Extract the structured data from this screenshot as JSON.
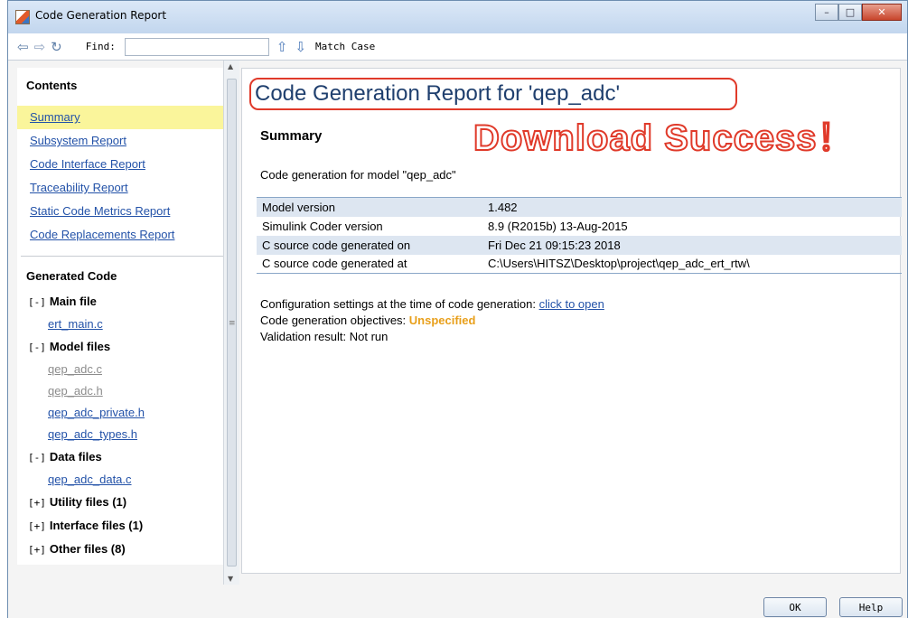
{
  "window": {
    "title": "Code Generation Report"
  },
  "toolbar": {
    "back_icon": "arrow-left-icon",
    "forward_icon": "arrow-right-icon",
    "refresh_icon": "refresh-icon",
    "find_label": "Find:",
    "find_value": "",
    "match_case_label": "Match Case"
  },
  "sidebar": {
    "contents_heading": "Contents",
    "links": [
      {
        "label": "Summary"
      },
      {
        "label": "Subsystem Report"
      },
      {
        "label": "Code Interface Report"
      },
      {
        "label": "Traceability Report"
      },
      {
        "label": "Static Code Metrics Report"
      },
      {
        "label": "Code Replacements Report"
      }
    ],
    "generated_heading": "Generated Code",
    "groups": {
      "main": {
        "toggle": "[-]",
        "label": "Main file",
        "files": [
          "ert_main.c"
        ]
      },
      "model": {
        "toggle": "[-]",
        "label": "Model files",
        "files": [
          "qep_adc.c",
          "qep_adc.h",
          "qep_adc_private.h",
          "qep_adc_types.h"
        ]
      },
      "data": {
        "toggle": "[-]",
        "label": "Data files",
        "files": [
          "qep_adc_data.c"
        ]
      },
      "utility": {
        "toggle": "[+]",
        "label": "Utility files (1)"
      },
      "interface": {
        "toggle": "[+]",
        "label": "Interface files (1)"
      },
      "other": {
        "toggle": "[+]",
        "label": "Other files (8)"
      }
    }
  },
  "report": {
    "title": "Code Generation Report for 'qep_adc'",
    "overlay": "Download Success！",
    "summary_heading": "Summary",
    "model_line": "Code generation for model \"qep_adc\"",
    "table": [
      {
        "key": "Model version",
        "value": "1.482"
      },
      {
        "key": "Simulink Coder version",
        "value": "8.9 (R2015b) 13-Aug-2015"
      },
      {
        "key": "C source code generated on",
        "value": "Fri Dec 21 09:15:23 2018"
      },
      {
        "key": "C source code generated at",
        "value": "C:\\Users\\HITSZ\\Desktop\\project\\qep_adc_ert_rtw\\"
      }
    ],
    "config_prefix": "Configuration settings at the time of code generation: ",
    "config_link": "click to open",
    "objectives_prefix": "Code generation objectives: ",
    "objectives_value": "Unspecified",
    "validation": "Validation result: Not run"
  },
  "buttons": {
    "ok": "OK",
    "help": "Help"
  }
}
